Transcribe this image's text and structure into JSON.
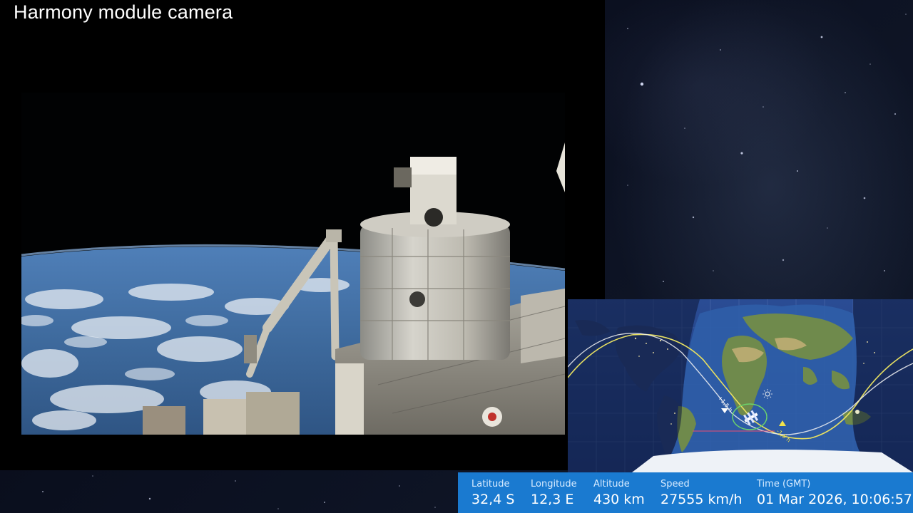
{
  "camera": {
    "title": "Harmony module camera"
  },
  "map": {
    "orbit_labels": {
      "plus": "+1,5 h",
      "minus": "-1,5 h"
    },
    "colors": {
      "ocean": "#1f3a7a",
      "night_overlay": "#0c1838",
      "land": "#6f8a4c",
      "ice": "#eef2f7",
      "track_future": "#e8e061",
      "track_past": "#f2f2f2"
    },
    "icons": [
      "iss-icon",
      "sun-icon",
      "moon-icon"
    ]
  },
  "telemetry": {
    "latitude_label": "Latitude",
    "latitude_value": "32,4 S",
    "longitude_label": "Longitude",
    "longitude_value": "12,3 E",
    "altitude_label": "Altitude",
    "altitude_value": "430 km",
    "speed_label": "Speed",
    "speed_value": "27555 km/h",
    "time_label": "Time (GMT)",
    "time_value": "01 Mar 2026, 10:06:57"
  }
}
